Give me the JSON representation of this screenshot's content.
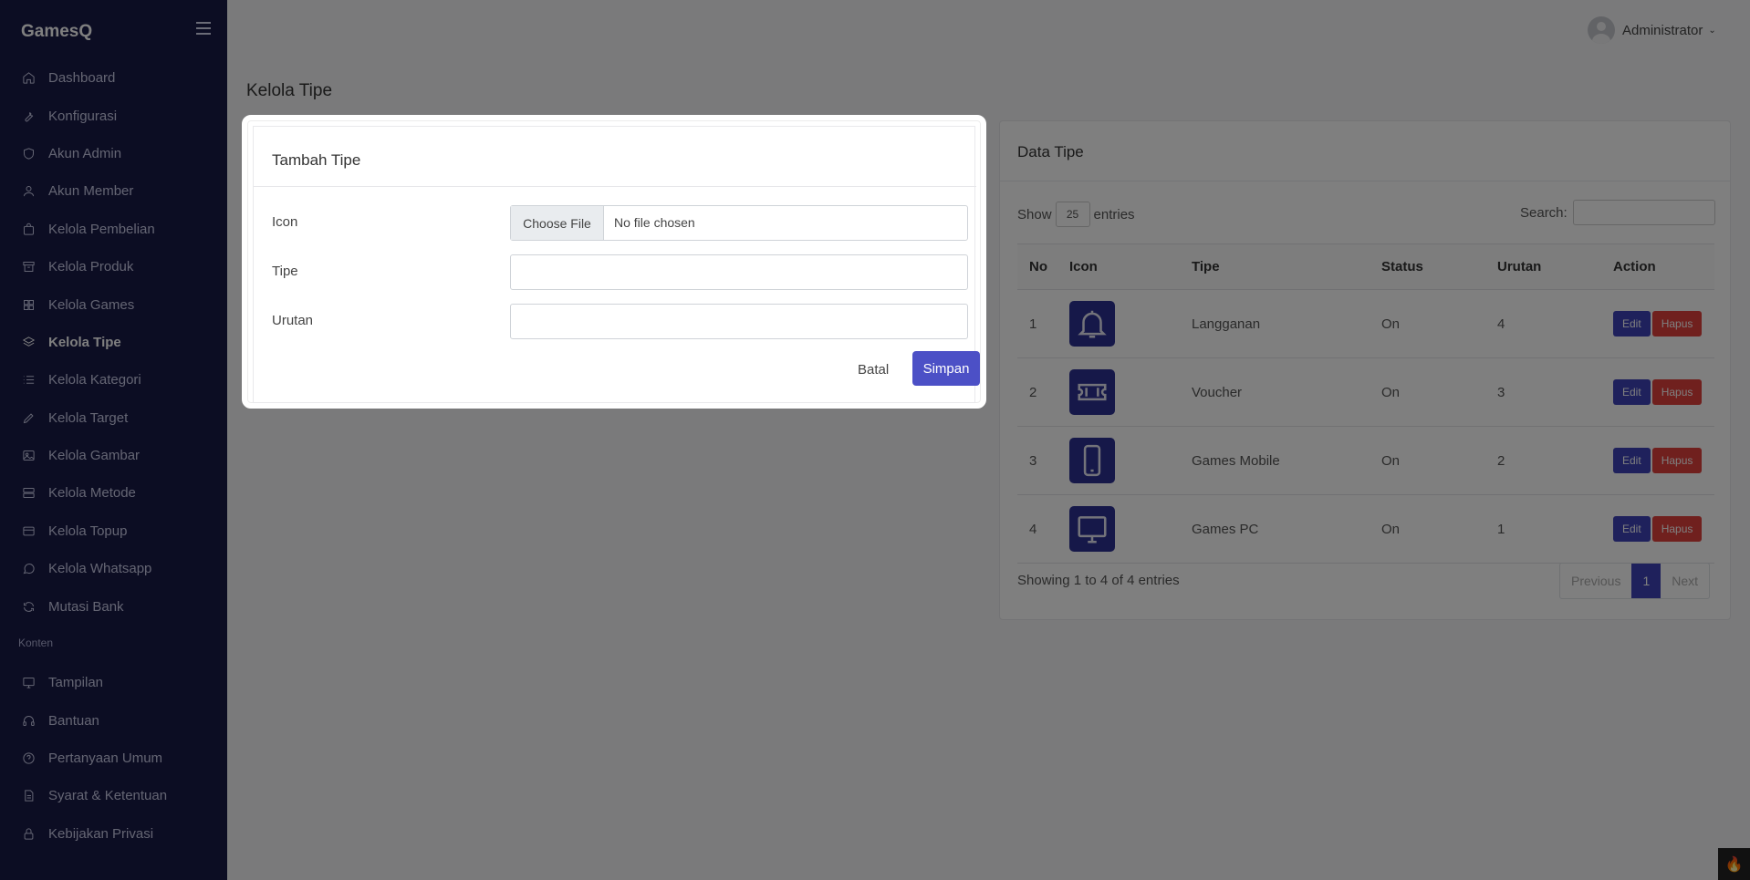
{
  "sidebar": {
    "brand": "GamesQ",
    "items": [
      {
        "label": "Dashboard",
        "icon": "home-icon"
      },
      {
        "label": "Konfigurasi",
        "icon": "wrench-icon"
      },
      {
        "label": "Akun Admin",
        "icon": "shield-icon"
      },
      {
        "label": "Akun Member",
        "icon": "user-icon"
      },
      {
        "label": "Kelola Pembelian",
        "icon": "bag-icon"
      },
      {
        "label": "Kelola Produk",
        "icon": "archive-icon"
      },
      {
        "label": "Kelola Games",
        "icon": "grid-icon"
      },
      {
        "label": "Kelola Tipe",
        "icon": "layers-icon",
        "active": true
      },
      {
        "label": "Kelola Kategori",
        "icon": "list-icon"
      },
      {
        "label": "Kelola Target",
        "icon": "pen-icon"
      },
      {
        "label": "Kelola Gambar",
        "icon": "image-icon"
      },
      {
        "label": "Kelola Metode",
        "icon": "server-icon"
      },
      {
        "label": "Kelola Topup",
        "icon": "card-icon"
      },
      {
        "label": "Kelola Whatsapp",
        "icon": "chat-icon"
      },
      {
        "label": "Mutasi Bank",
        "icon": "refresh-icon"
      }
    ],
    "section_label": "Konten",
    "items2": [
      {
        "label": "Tampilan",
        "icon": "monitor-icon"
      },
      {
        "label": "Bantuan",
        "icon": "headset-icon"
      },
      {
        "label": "Pertanyaan Umum",
        "icon": "help-icon"
      },
      {
        "label": "Syarat & Ketentuan",
        "icon": "document-icon"
      },
      {
        "label": "Kebijakan Privasi",
        "icon": "lock-icon"
      }
    ]
  },
  "topbar": {
    "user_name": "Administrator"
  },
  "page": {
    "title": "Kelola Tipe"
  },
  "data_card": {
    "title": "Data Tipe",
    "show_label": "Show",
    "show_value": "25",
    "entries_label": "entries",
    "search_label": "Search:",
    "columns": [
      "No",
      "Icon",
      "Tipe",
      "Status",
      "Urutan",
      "Action"
    ],
    "rows": [
      {
        "no": "1",
        "icon": "bell-icon",
        "tipe": "Langganan",
        "status": "On",
        "urutan": "4"
      },
      {
        "no": "2",
        "icon": "ticket-icon",
        "tipe": "Voucher",
        "status": "On",
        "urutan": "3"
      },
      {
        "no": "3",
        "icon": "phone-icon",
        "tipe": "Games Mobile",
        "status": "On",
        "urutan": "2"
      },
      {
        "no": "4",
        "icon": "monitor-icon",
        "tipe": "Games PC",
        "status": "On",
        "urutan": "1"
      }
    ],
    "edit_label": "Edit",
    "hapus_label": "Hapus",
    "showing_text": "Showing 1 to 4 of 4 entries",
    "pager": {
      "previous": "Previous",
      "current": "1",
      "next": "Next"
    }
  },
  "modal": {
    "title": "Tambah Tipe",
    "icon_label": "Icon",
    "choose_file": "Choose File",
    "no_file": "No file chosen",
    "tipe_label": "Tipe",
    "urutan_label": "Urutan",
    "batal_label": "Batal",
    "simpan_label": "Simpan"
  },
  "colors": {
    "sidebar": "#191a47",
    "primary": "#4c50c6",
    "danger": "#e0403c"
  }
}
